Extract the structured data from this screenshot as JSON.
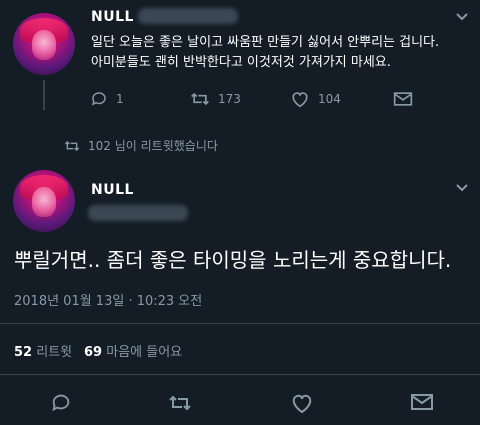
{
  "tweet1": {
    "name": "NULL",
    "text_line1": "일단 오늘은 좋은 날이고 싸움판 만들기 싫어서 안뿌리는 겁니다.",
    "text_line2": "아미분들도 괜히 반박한다고 이것저것 가져가지 마세요.",
    "actions": {
      "reply_count": "1",
      "retweet_count": "173",
      "like_count": "104"
    }
  },
  "retweet_notice": "102 님이 리트윗했습니다",
  "tweet2": {
    "name": "NULL",
    "text": "뿌릴거면.. 좀더 좋은 타이밍을 노리는게 중요합니다.",
    "timestamp": "2018년 01월 13일 · 10:23 오전",
    "stats": {
      "retweets_value": "52",
      "retweets_label": "리트윗",
      "likes_value": "69",
      "likes_label": "마음에 들어요"
    }
  },
  "icons": [
    "reply-icon",
    "retweet-icon",
    "like-icon",
    "dm-icon",
    "chevron-down-icon"
  ],
  "colors": {
    "background": "#141d26",
    "muted": "#8899a6",
    "divider": "#38444d"
  }
}
